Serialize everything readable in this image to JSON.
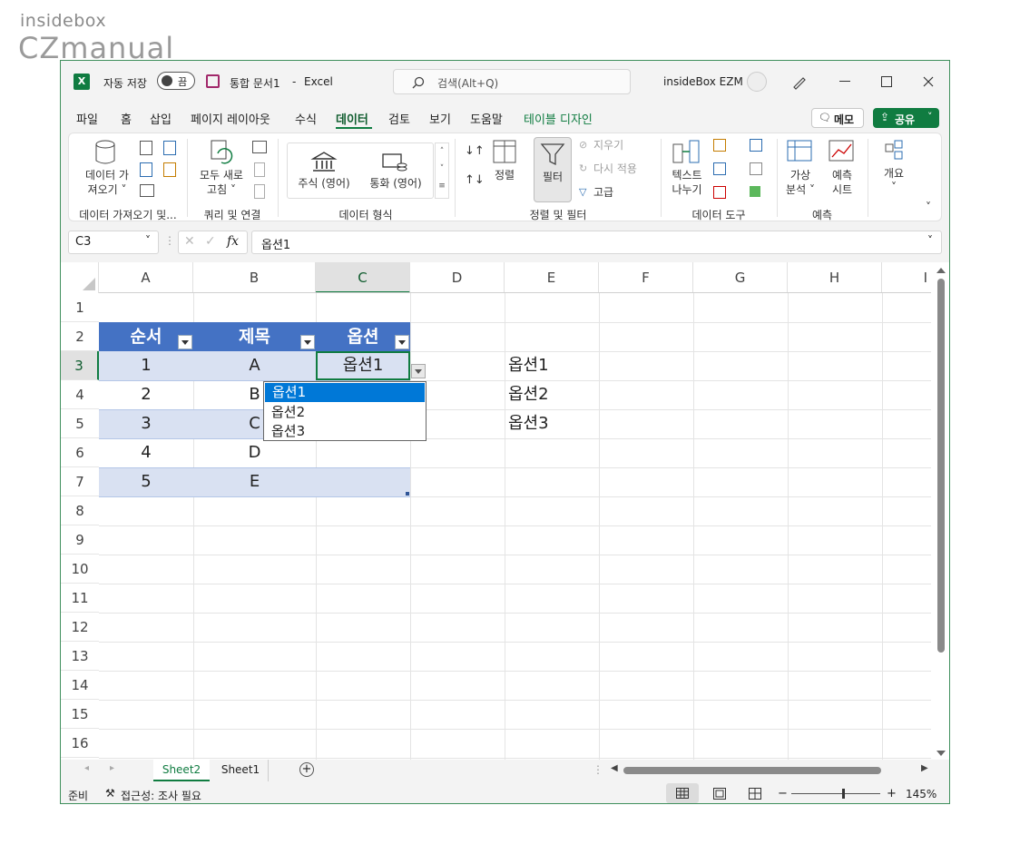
{
  "watermark": {
    "top": "insidebox",
    "bottom": "CZmanual"
  },
  "titlebar": {
    "autosave_label": "자동 저장",
    "autosave_state": "끔",
    "filename": "통합 문서1",
    "separator": "-",
    "app": "Excel",
    "search_placeholder": "검색(Alt+Q)",
    "user": "insideBox EZM"
  },
  "menu": {
    "items": [
      "파일",
      "홈",
      "삽입",
      "페이지 레이아웃",
      "수식",
      "데이터",
      "검토",
      "보기",
      "도움말",
      "테이블 디자인"
    ],
    "active": "데이터",
    "comment_button": "메모",
    "share_button": "공유"
  },
  "ribbon": {
    "get_data": {
      "line1": "데이터 가",
      "line2": "져오기 ˅",
      "group": "데이터 가져오기 및..."
    },
    "queries": {
      "line1": "모두 새로",
      "line2": "고침 ˅",
      "group": "쿼리 및 연결"
    },
    "data_types": {
      "stocks": "주식 (영어)",
      "currencies": "통화 (영어)",
      "group": "데이터 형식"
    },
    "sort_filter": {
      "sort": "정렬",
      "filter": "필터",
      "clear": "지우기",
      "reapply": "다시 적용",
      "advanced": "고급",
      "group": "정렬 및 필터"
    },
    "data_tools": {
      "line1": "텍스트",
      "line2": "나누기",
      "group": "데이터 도구"
    },
    "forecast": {
      "whatif1": "가상",
      "whatif2": "분석 ˅",
      "sheet1": "예측",
      "sheet2": "시트",
      "group": "예측"
    },
    "outline": {
      "label": "개요",
      "chevron": "˅"
    }
  },
  "formula_bar": {
    "namebox": "C3",
    "fx": "fx",
    "value": "옵션1"
  },
  "grid": {
    "columns": [
      "A",
      "B",
      "C",
      "D",
      "E",
      "F",
      "G",
      "H",
      "I"
    ],
    "rows": [
      "1",
      "2",
      "3",
      "4",
      "5",
      "6",
      "7",
      "8",
      "9",
      "10",
      "11",
      "12",
      "13",
      "14",
      "15",
      "16"
    ],
    "table_headers": [
      "순서",
      "제목",
      "옵션"
    ],
    "table_rows": [
      [
        "1",
        "A",
        "옵션1"
      ],
      [
        "2",
        "B",
        ""
      ],
      [
        "3",
        "C",
        ""
      ],
      [
        "4",
        "D",
        ""
      ],
      [
        "5",
        "E",
        ""
      ]
    ],
    "e_values": [
      "옵션1",
      "옵션2",
      "옵션3"
    ],
    "dropdown_options": [
      "옵션1",
      "옵션2",
      "옵션3"
    ],
    "dropdown_selected": "옵션1"
  },
  "sheets": {
    "tabs": [
      "Sheet2",
      "Sheet1"
    ],
    "active": "Sheet2",
    "add": "+"
  },
  "status": {
    "ready": "준비",
    "accessibility": "접근성: 조사 필요",
    "zoom": "145%",
    "zoom_minus": "−",
    "zoom_plus": "+"
  },
  "colors": {
    "accent": "#107c41",
    "header": "#4472c4",
    "band": "#d9e1f2",
    "selection": "#0078d7"
  }
}
